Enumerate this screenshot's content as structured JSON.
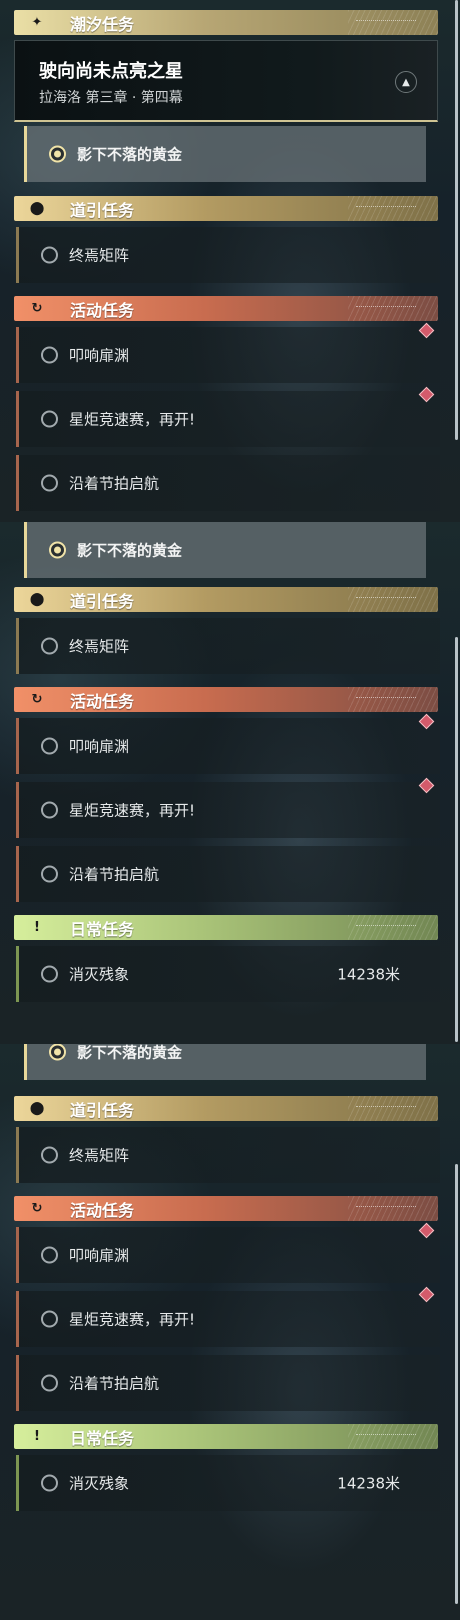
{
  "headers": {
    "tide": "潮汐任务",
    "guide": "道引任务",
    "event": "活动任务",
    "daily": "日常任务"
  },
  "icons": {
    "tide": "sparkle-icon",
    "guide": "location-pin-icon",
    "event": "refresh-icon",
    "daily": "exclamation-icon",
    "collapse": "chevron-up-icon",
    "alert": "diamond-marker-icon"
  },
  "main_quest": {
    "title": "驶向尚未点亮之星",
    "subtitle": "拉海洛 第三章 · 第四幕"
  },
  "active_quest": "影下不落的黄金",
  "guide_quest": "终焉矩阵",
  "event_quests": [
    "叩响扉渊",
    "星炬竞速赛，再开!",
    "沿着节拍启航"
  ],
  "daily_quest": {
    "label": "消灭残象",
    "distance": "14238米"
  },
  "colors": {
    "tide": "#d8cc95",
    "guide": "#d2bb7e",
    "event": "#e07a5a",
    "daily": "#bcd98a",
    "alert": "#d35b6b"
  }
}
